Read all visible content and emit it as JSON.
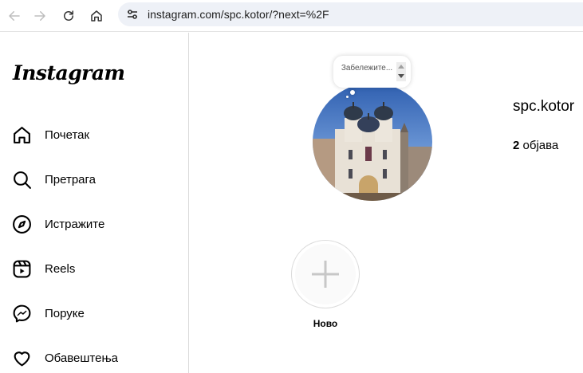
{
  "browser": {
    "url": "instagram.com/spc.kotor/?next=%2F",
    "icons": [
      "back-arrow-icon",
      "forward-arrow-icon",
      "reload-icon",
      "home-icon",
      "site-settings-icon"
    ]
  },
  "sidebar": {
    "logo": "Instagram",
    "items": [
      {
        "label": "Почетак",
        "icon": "home-icon"
      },
      {
        "label": "Претрага",
        "icon": "search-icon"
      },
      {
        "label": "Истражите",
        "icon": "compass-icon"
      },
      {
        "label": "Reels",
        "icon": "reels-icon"
      },
      {
        "label": "Поруке",
        "icon": "messenger-icon"
      },
      {
        "label": "Обавештења",
        "icon": "heart-icon"
      }
    ]
  },
  "profile": {
    "note": "Забележите...",
    "username": "spc.kotor",
    "posts_count": "2",
    "posts_label": "објава",
    "new_highlight_label": "Ново"
  },
  "colors": {
    "url_bar_bg": "#eef1f7",
    "divider": "#dbdbdb"
  }
}
